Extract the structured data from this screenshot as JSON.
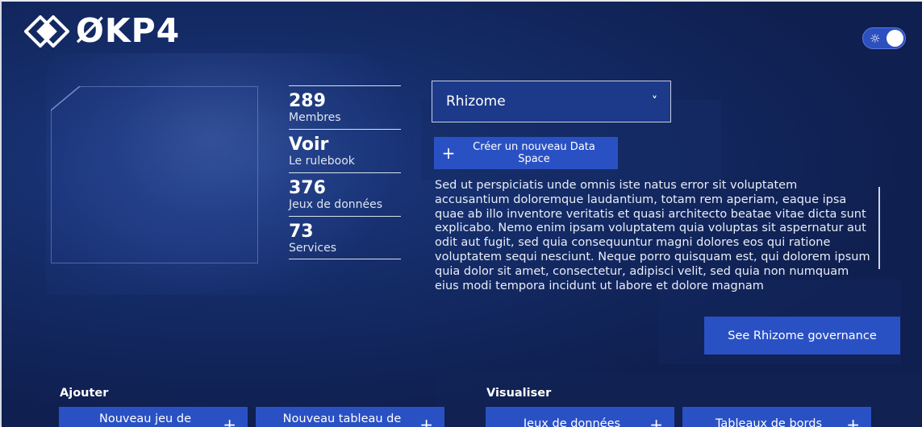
{
  "brand": {
    "logo_text": "ØKP4"
  },
  "theme_toggle": {
    "icon": "sun-icon",
    "state": "on"
  },
  "stats": [
    {
      "value": "289",
      "label": "Membres"
    },
    {
      "value": "Voir",
      "label": "Le rulebook"
    },
    {
      "value": "376",
      "label": "Jeux de données"
    },
    {
      "value": "73",
      "label": "Services"
    }
  ],
  "dataspace_select": {
    "selected": "Rhizome"
  },
  "create_button": {
    "label": "Créer un nouveau Data Space"
  },
  "description": "Sed ut perspiciatis unde omnis iste natus error sit voluptatem accusantium doloremque laudantium, totam rem aperiam, eaque ipsa quae ab illo inventore veritatis et quasi architecto beatae vitae dicta sunt explicabo. Nemo enim ipsam voluptatem quia voluptas sit aspernatur aut odit aut fugit, sed quia consequuntur magni dolores eos qui ratione voluptatem sequi nesciunt. Neque porro quisquam est, qui dolorem ipsum quia dolor sit amet, consectetur, adipisci velit, sed quia non numquam eius modi tempora incidunt ut labore et dolore magnam",
  "governance_button": {
    "label": "See Rhizome governance"
  },
  "add_section": {
    "title": "Ajouter",
    "buttons": [
      "Nouveau jeu de",
      "Nouveau tableau de"
    ]
  },
  "view_section": {
    "title": "Visualiser",
    "buttons": [
      "Jeux de données",
      "Tableaux de bords"
    ]
  }
}
